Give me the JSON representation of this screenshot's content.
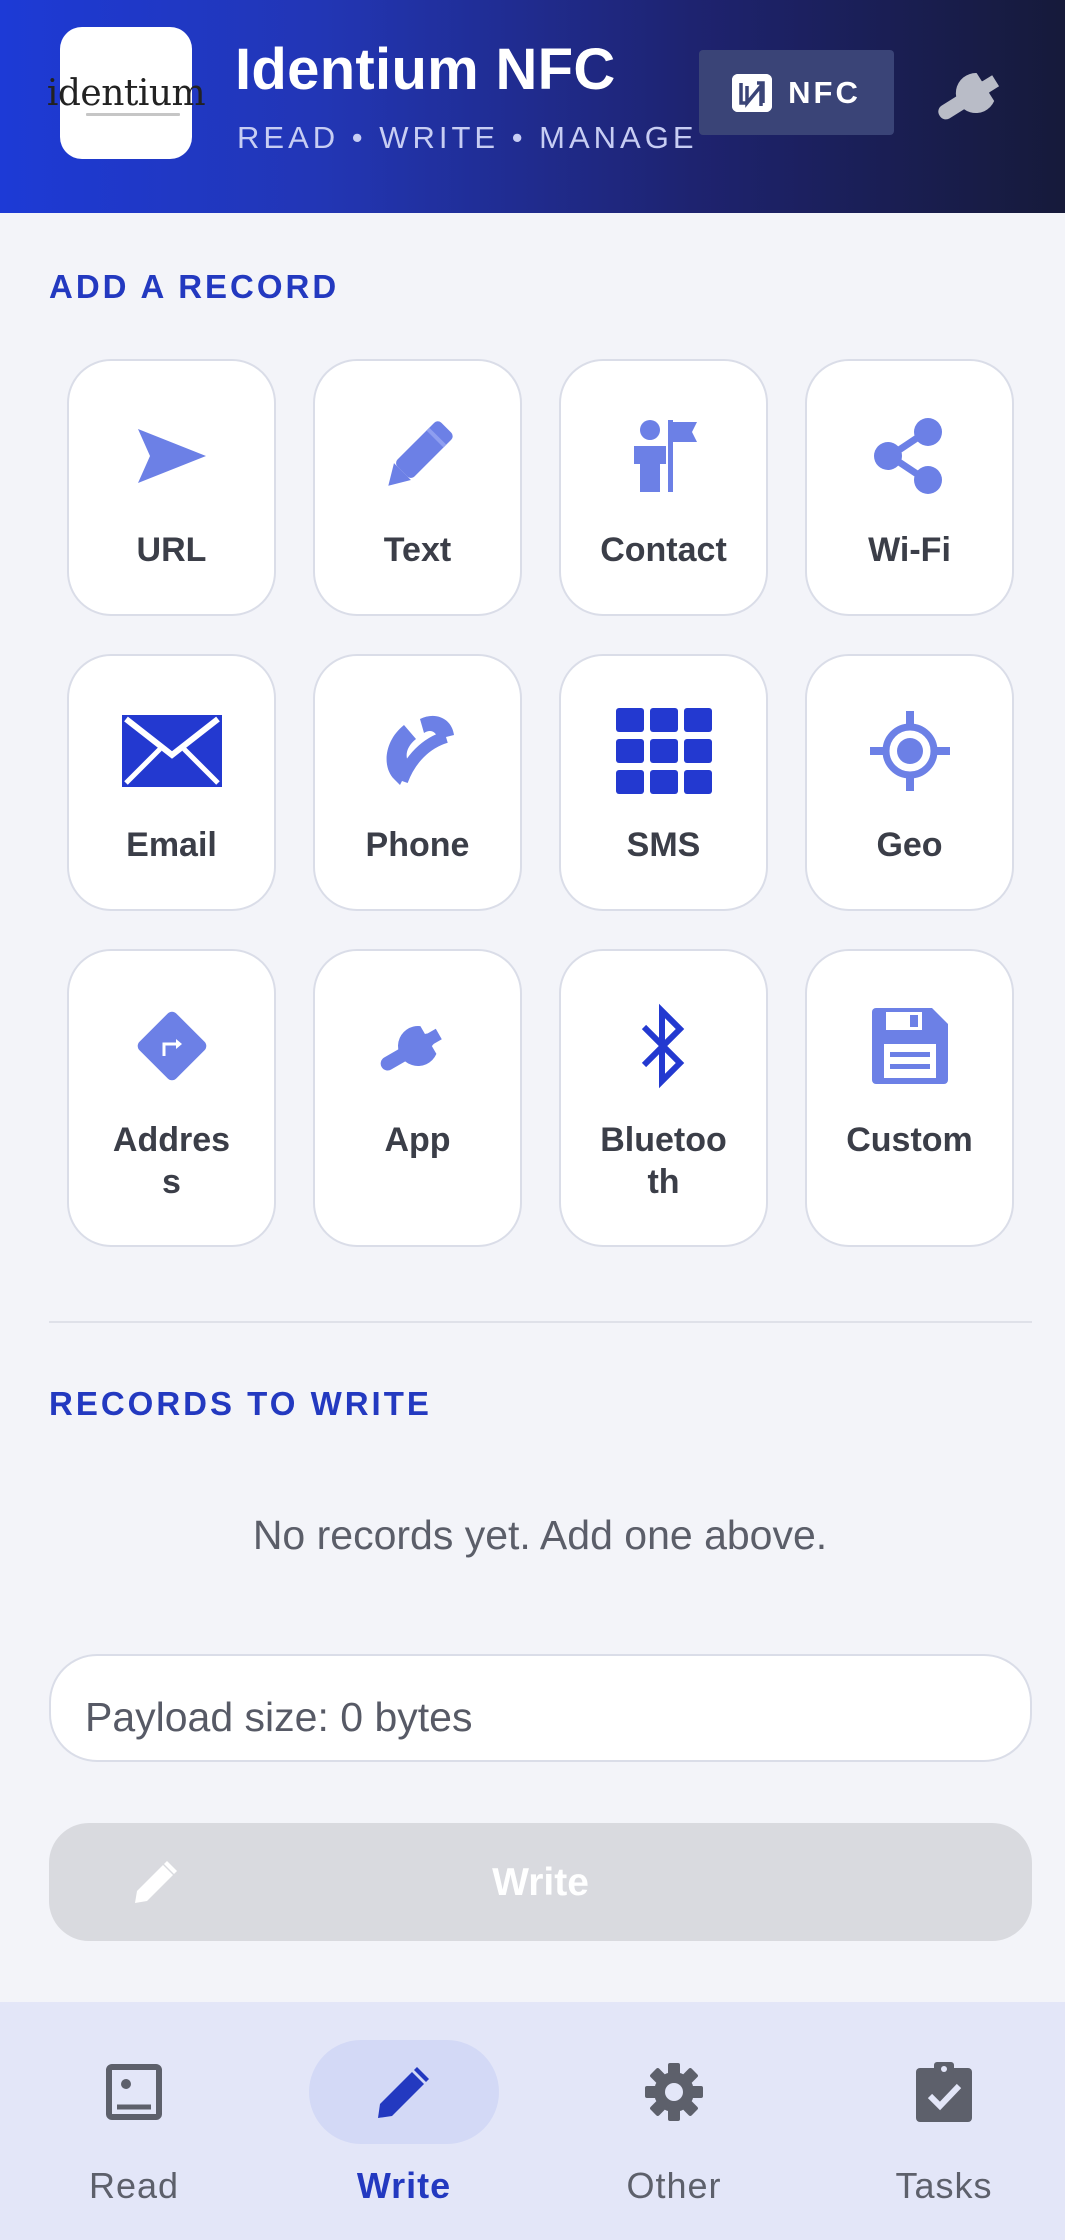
{
  "header": {
    "logo_text": "identium",
    "title": "Identium NFC",
    "subtitle": "READ • WRITE • MANAGE",
    "nfc_badge": "NFC",
    "settings_icon": "wrench-icon"
  },
  "add_record": {
    "title": "ADD A RECORD",
    "tiles": [
      {
        "label": "URL",
        "icon": "send-icon"
      },
      {
        "label": "Text",
        "icon": "pencil-icon"
      },
      {
        "label": "Contact",
        "icon": "person-flag-icon"
      },
      {
        "label": "Wi-Fi",
        "icon": "share-icon"
      },
      {
        "label": "Email",
        "icon": "envelope-icon"
      },
      {
        "label": "Phone",
        "icon": "phone-icon"
      },
      {
        "label": "SMS",
        "icon": "grid-icon"
      },
      {
        "label": "Geo",
        "icon": "crosshair-icon"
      },
      {
        "label": "Addres\ns",
        "icon": "directions-icon"
      },
      {
        "label": "App",
        "icon": "wrench-icon"
      },
      {
        "label": "Bluetoo\nth",
        "icon": "bluetooth-icon"
      },
      {
        "label": "Custom",
        "icon": "save-icon"
      }
    ]
  },
  "records": {
    "title": "RECORDS TO WRITE",
    "empty_message": "No records yet. Add one above.",
    "payload_label": "Payload size: 0 bytes"
  },
  "write_button": {
    "label": "Write",
    "icon": "pencil-icon",
    "enabled": false
  },
  "bottom_nav": {
    "items": [
      {
        "label": "Read",
        "icon": "image-icon",
        "active": false
      },
      {
        "label": "Write",
        "icon": "pencil-icon",
        "active": true
      },
      {
        "label": "Other",
        "icon": "gear-icon",
        "active": false
      },
      {
        "label": "Tasks",
        "icon": "clipboard-check-icon",
        "active": false
      }
    ]
  },
  "colors": {
    "accent": "#2339c0",
    "icon_light": "#6c80e6",
    "icon_dark": "#2339d0",
    "background": "#f3f4f9"
  }
}
